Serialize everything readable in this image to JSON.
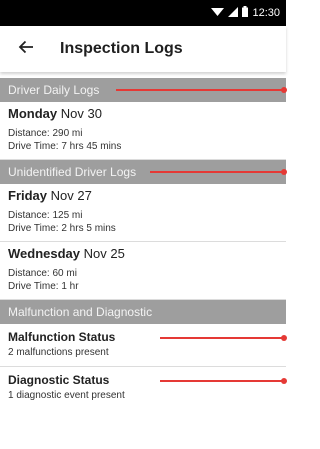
{
  "status_bar": {
    "time": "12:30",
    "icons": [
      "wifi-icon",
      "signal-icon",
      "battery-icon"
    ]
  },
  "header": {
    "back_icon": "arrow-left-icon",
    "title": "Inspection Logs"
  },
  "sections": {
    "daily": {
      "title": "Driver Daily Logs",
      "entries": [
        {
          "day": "Monday",
          "date": "Nov 30",
          "distance": "Distance: 290 mi",
          "drive_time": "Drive Time: 7 hrs 45 mins"
        }
      ]
    },
    "unidentified": {
      "title": "Unidentified Driver Logs",
      "entries": [
        {
          "day": "Friday",
          "date": "Nov 27",
          "distance": "Distance: 125 mi",
          "drive_time": "Drive Time: 2 hrs 5 mins"
        },
        {
          "day": "Wednesday",
          "date": "Nov 25",
          "distance": "Distance: 60 mi",
          "drive_time": "Drive Time: 1 hr"
        }
      ]
    },
    "malfunction": {
      "title": "Malfunction and Diagnostic",
      "items": [
        {
          "title": "Malfunction Status",
          "subtitle": "2 malfunctions present"
        },
        {
          "title": "Diagnostic Status",
          "subtitle": "1 diagnostic event present"
        }
      ]
    }
  },
  "colors": {
    "status_bar": "#000000",
    "section_header": "#9e9e9e",
    "annotation_red": "#e53935"
  }
}
